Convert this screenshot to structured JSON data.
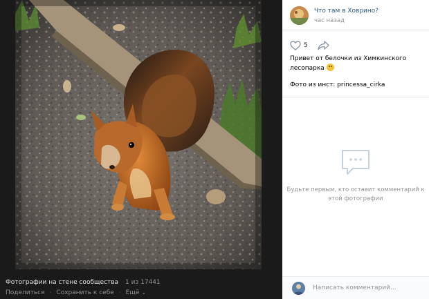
{
  "viewer": {
    "album_title": "Фотографии на стене сообщества",
    "counter": "1 из 17441",
    "share_label": "Поделиться",
    "save_label": "Сохранить к себе",
    "more_label": "Ещё"
  },
  "post": {
    "community_name": "Что там в Ховрино?",
    "time": "час назад",
    "likes": "5",
    "caption": "Привет от белочки из Химкинского лесопарка",
    "credit": "Фото из инст: princessa_cirka"
  },
  "comments": {
    "empty_text": "Будьте первым, кто оставит комментарий к этой фотографии",
    "input_placeholder": "Написать комментарий..."
  },
  "colors": {
    "link": "#2a5885",
    "muted": "#939393",
    "viewer_bg": "#1a1a1b"
  },
  "icons": [
    "heart-icon",
    "share-arrow-icon",
    "comments-empty-icon",
    "chevron-down-icon"
  ]
}
